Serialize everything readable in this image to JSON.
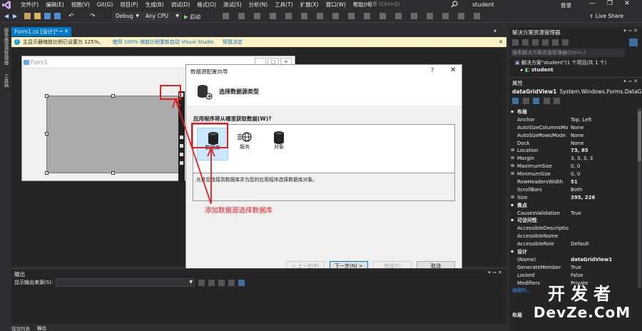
{
  "menubar": {
    "items": [
      "文件(F)",
      "编辑(E)",
      "视图(V)",
      "Git(G)",
      "项目(P)",
      "生成(B)",
      "调试(D)",
      "格式(O)",
      "测试(S)",
      "分析(N)",
      "工具(T)",
      "扩展(X)",
      "窗口(W)",
      "帮助(H)"
    ],
    "search_placeholder": "搜索 (Ctrl+Q)",
    "solution_name": "student",
    "login": "登录",
    "live_share": "Live Share"
  },
  "toolbar": {
    "config": "Debug",
    "platform": "Any CPU",
    "start": "启动"
  },
  "left_strip": {
    "items": [
      "服务器资源管理器",
      "工具箱"
    ]
  },
  "document": {
    "tab_label": "Form1.cs [设计]*",
    "info_text": "主显示器缩放比例已设置为 125%。",
    "info_link1": "使用 100% 缩放比例重新启动 Visual Studio",
    "info_link2": "帮我决定",
    "form_title": "Form1"
  },
  "wizard": {
    "title": "数据源配置向导",
    "help": "?",
    "header_title": "选择数据源类型",
    "question": "应用程序将从哪里获取数据(W)?",
    "items": [
      {
        "label": "数据库",
        "icon": "database-icon",
        "selected": true
      },
      {
        "label": "服务",
        "icon": "service-icon",
        "selected": false
      },
      {
        "label": "对象",
        "icon": "object-icon",
        "selected": false
      }
    ],
    "description": "允许您连接到数据库并为您的应用程序选择数据库对象。",
    "buttons": {
      "prev": "< 上一步(P)",
      "next": "下一步(N) >",
      "finish": "完成(F)",
      "cancel": "取消"
    }
  },
  "annotation": {
    "note": "添加数据源选择数据库",
    "color": "#e02020"
  },
  "output": {
    "title": "输出",
    "source_label": "显示输出来源(S):",
    "tabs": [
      "错误列表",
      "输出"
    ]
  },
  "solution_explorer": {
    "title": "解决方案资源管理器",
    "search_placeholder": "搜索解决方案资源管理器(Ctrl+;)",
    "solution_node": "解决方案\"student\"(1 个项目/共 1 个)",
    "project_node": "student"
  },
  "properties": {
    "title": "属性",
    "object_name": "dataGridView1",
    "object_type": "System.Windows.Forms.DataG",
    "rows": [
      {
        "name": "布局",
        "cat": true
      },
      {
        "name": "Anchor",
        "value": "Top, Left"
      },
      {
        "name": "AutoSizeColumnsMo",
        "value": "None"
      },
      {
        "name": "AutoSizeRowsMode",
        "value": "None"
      },
      {
        "name": "Dock",
        "value": "None"
      },
      {
        "name": "Location",
        "value": "73, 85",
        "bold": true,
        "exp": true
      },
      {
        "name": "Margin",
        "value": "3, 3, 3, 3",
        "exp": true
      },
      {
        "name": "MaximumSize",
        "value": "0, 0",
        "exp": true
      },
      {
        "name": "MinimumSize",
        "value": "0, 0",
        "exp": true
      },
      {
        "name": "RowHeadersWidth",
        "value": "51",
        "bold": true
      },
      {
        "name": "ScrollBars",
        "value": "Both"
      },
      {
        "name": "Size",
        "value": "395, 226",
        "bold": true,
        "exp": true
      },
      {
        "name": "焦点",
        "cat": true
      },
      {
        "name": "CausesValidation",
        "value": "True"
      },
      {
        "name": "可访问性",
        "cat": true
      },
      {
        "name": "AccessibleDescriptio",
        "value": ""
      },
      {
        "name": "AccessibleName",
        "value": ""
      },
      {
        "name": "AccessibleRole",
        "value": "Default"
      },
      {
        "name": "设计",
        "cat": true
      },
      {
        "name": "(Name)",
        "value": "dataGridView1",
        "bold": true
      },
      {
        "name": "GenerateMember",
        "value": "True"
      },
      {
        "name": "Locked",
        "value": "False"
      },
      {
        "name": "Modifiers",
        "value": "Private"
      }
    ],
    "link": "编辑列...",
    "desc_title": "布局"
  },
  "watermark": {
    "line1": "开发者",
    "line2": "DevZe.CoM"
  }
}
